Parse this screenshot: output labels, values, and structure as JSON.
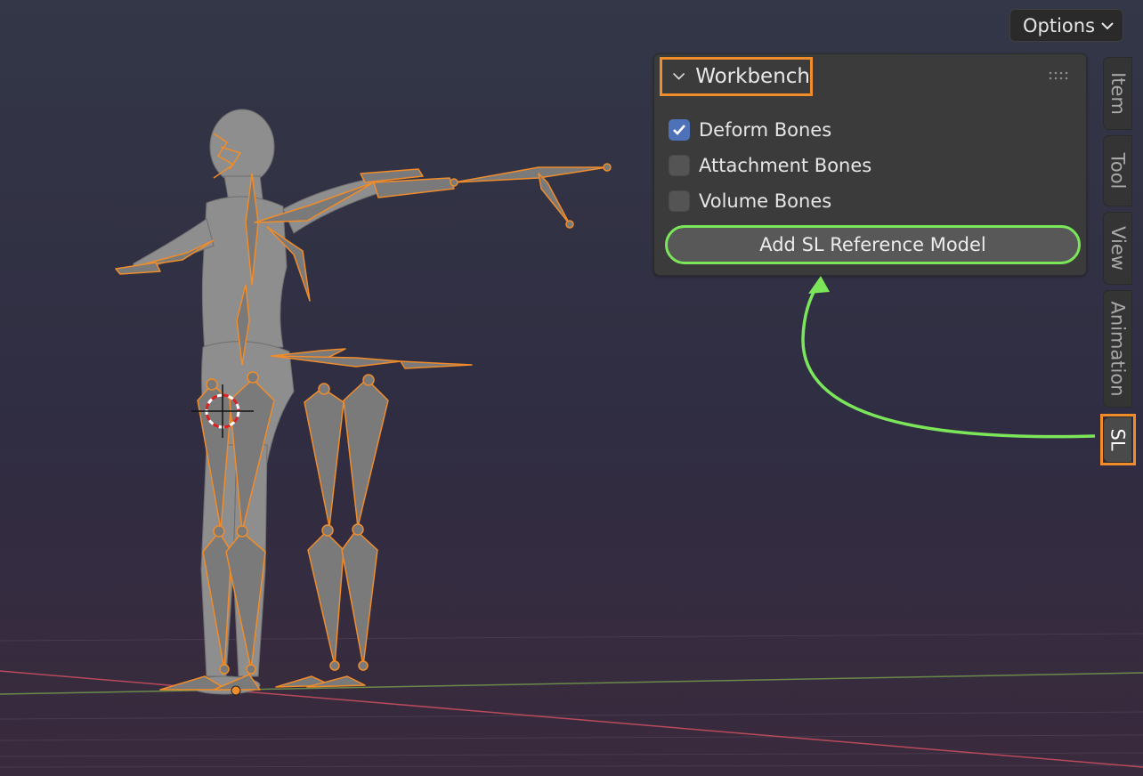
{
  "header": {
    "options_label": "Options"
  },
  "panel": {
    "title": "Workbench",
    "properties": [
      {
        "label": "Deform Bones",
        "checked": true
      },
      {
        "label": "Attachment Bones",
        "checked": false
      },
      {
        "label": "Volume Bones",
        "checked": false
      }
    ],
    "operator_button": "Add SL Reference Model"
  },
  "sidebar_tabs": [
    {
      "label": "Item",
      "active": false
    },
    {
      "label": "Tool",
      "active": false
    },
    {
      "label": "View",
      "active": false
    },
    {
      "label": "Animation",
      "active": false
    },
    {
      "label": "SL",
      "active": true
    }
  ],
  "colors": {
    "selection_outline": "#f08c2a",
    "annotation_green": "#7be65a",
    "checkbox_checked": "#4d72b8",
    "axis_x": "#b84a5a",
    "axis_y": "#6b8a4a"
  }
}
